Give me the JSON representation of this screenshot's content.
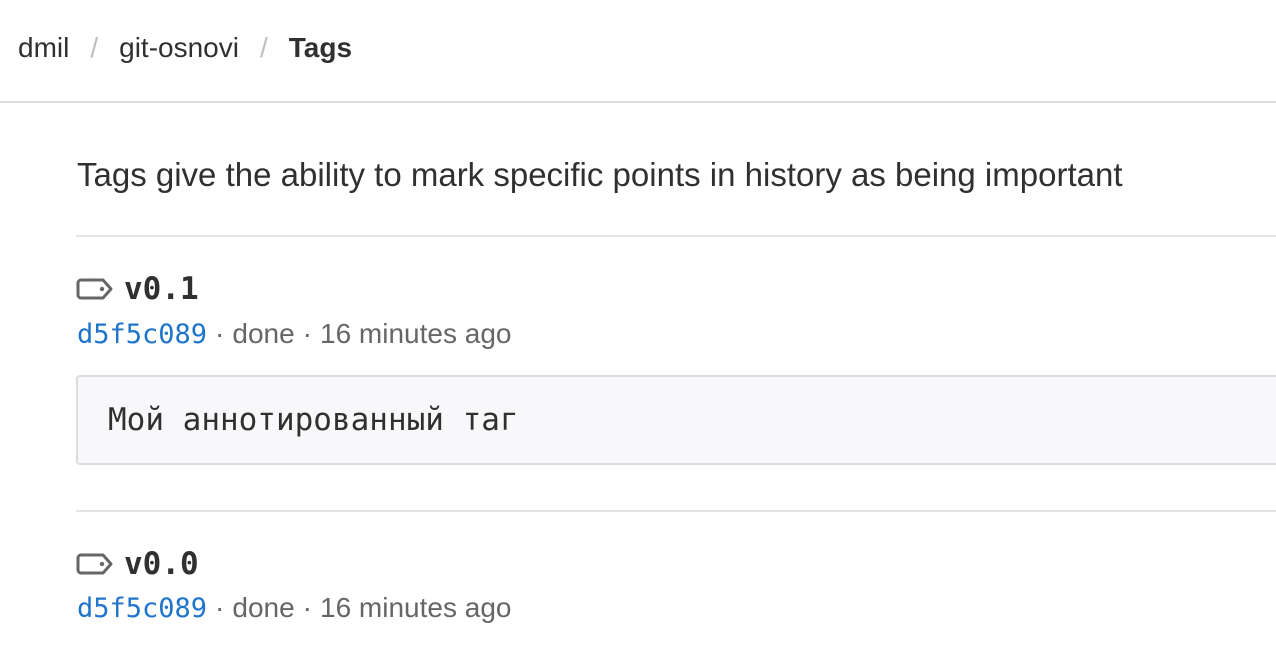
{
  "breadcrumb": {
    "items": [
      {
        "label": "dmil"
      },
      {
        "label": "git-osnovi"
      },
      {
        "label": "Tags"
      }
    ],
    "separator": "/"
  },
  "intro": {
    "text": "Tags give the ability to mark specific points in history as being important"
  },
  "tags": [
    {
      "icon": "tag-icon",
      "name": "v0.1",
      "commit": "d5f5c089",
      "commit_message": "done",
      "time": "16 minutes ago",
      "annotation": "Мой аннотированный таг"
    },
    {
      "icon": "tag-icon",
      "name": "v0.0",
      "commit": "d5f5c089",
      "commit_message": "done",
      "time": "16 minutes ago"
    }
  ],
  "meta_separator": "·",
  "colors": {
    "text": "#303030",
    "muted": "#666666",
    "link": "#1f75cb",
    "divider": "#dcdcde",
    "annotation_bg": "#f8f8fa"
  }
}
